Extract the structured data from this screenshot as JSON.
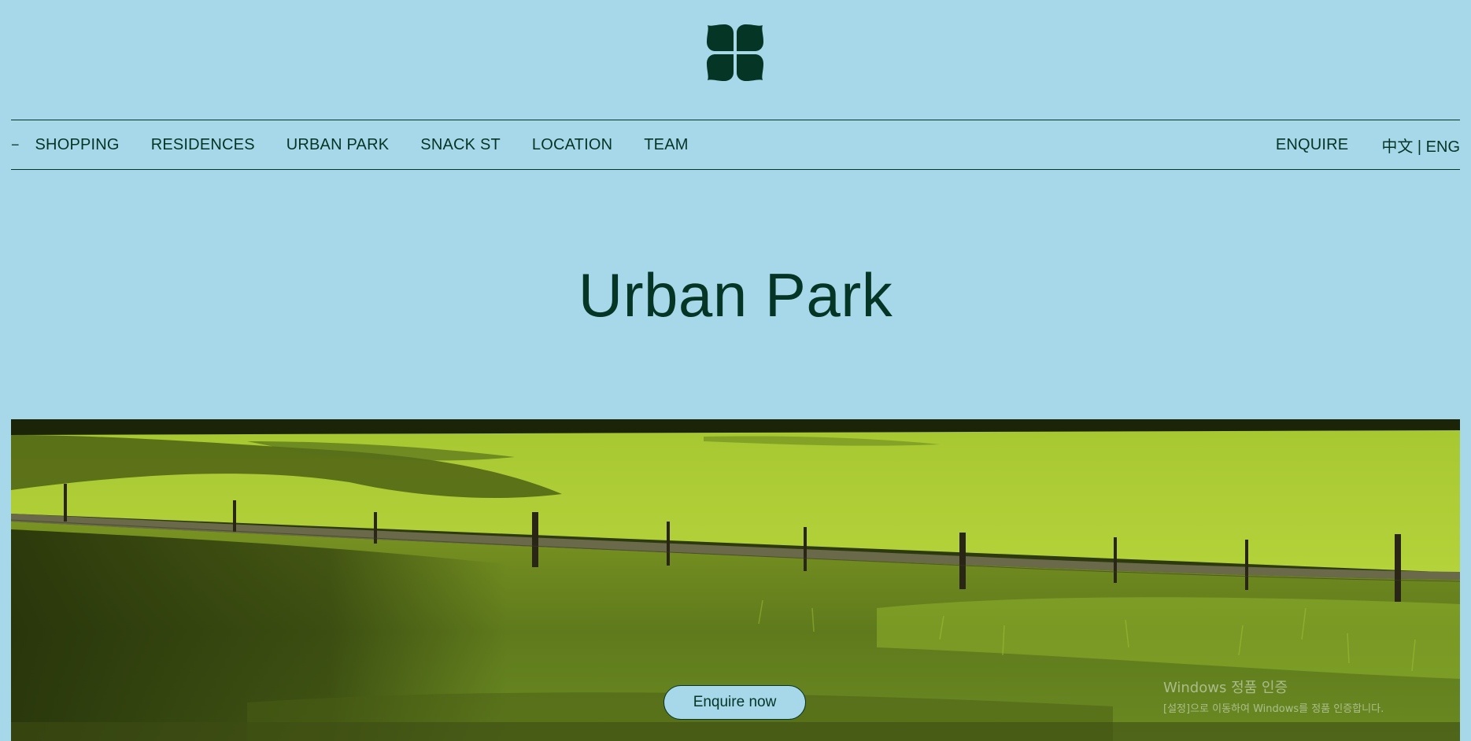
{
  "header": {
    "logo_icon": "four-petal-flower-logo",
    "brand_color": "#053524",
    "background_color": "#a6d8ea"
  },
  "nav": {
    "dash": "−",
    "items": [
      {
        "label": "SHOPPING"
      },
      {
        "label": "RESIDENCES"
      },
      {
        "label": "URBAN PARK"
      },
      {
        "label": "SNACK ST"
      },
      {
        "label": "LOCATION"
      },
      {
        "label": "TEAM"
      }
    ],
    "enquire_label": "ENQUIRE",
    "lang": {
      "zh": "中文",
      "separator": " | ",
      "en": "ENG"
    }
  },
  "main": {
    "title": "Urban Park",
    "cta_label": "Enquire now"
  },
  "watermark": {
    "title": "Windows 정품 인증",
    "subtitle": "[설정]으로 이동하여 Windows를 정품 인증합니다."
  }
}
